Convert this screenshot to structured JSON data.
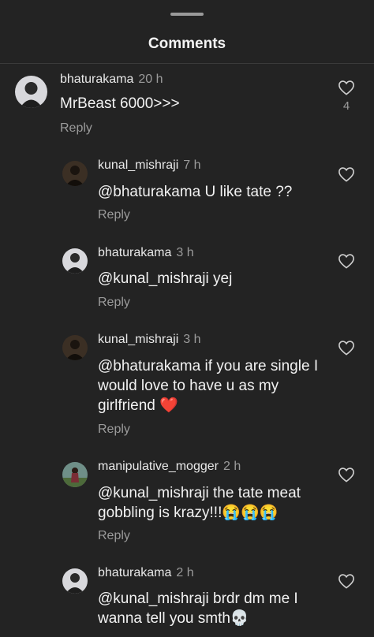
{
  "header": {
    "title": "Comments"
  },
  "comments": [
    {
      "username": "bhaturakama",
      "time": "20 h",
      "text": "MrBeast 6000>>>",
      "reply": "Reply",
      "likes": "4"
    },
    {
      "username": "kunal_mishraji",
      "time": "7 h",
      "text": "@bhaturakama U like tate ??",
      "reply": "Reply"
    },
    {
      "username": "bhaturakama",
      "time": "3 h",
      "text": "@kunal_mishraji yej",
      "reply": "Reply"
    },
    {
      "username": "kunal_mishraji",
      "time": "3 h",
      "text": "@bhaturakama if you are single I would love to have u as my girlfriend ❤️",
      "reply": "Reply"
    },
    {
      "username": "manipulative_mogger",
      "time": "2 h",
      "text": "@kunal_mishraji the tate meat gobbling is krazy!!!😭😭😭",
      "reply": "Reply"
    },
    {
      "username": "bhaturakama",
      "time": "2 h",
      "text": "@kunal_mishraji brdr dm me I wanna tell you smth💀"
    }
  ],
  "icons": {
    "like": "heart-outline-icon"
  },
  "colors": {
    "background": "#232323",
    "secondary_text": "#9b9b9b",
    "primary_text": "#f2f2f2"
  }
}
